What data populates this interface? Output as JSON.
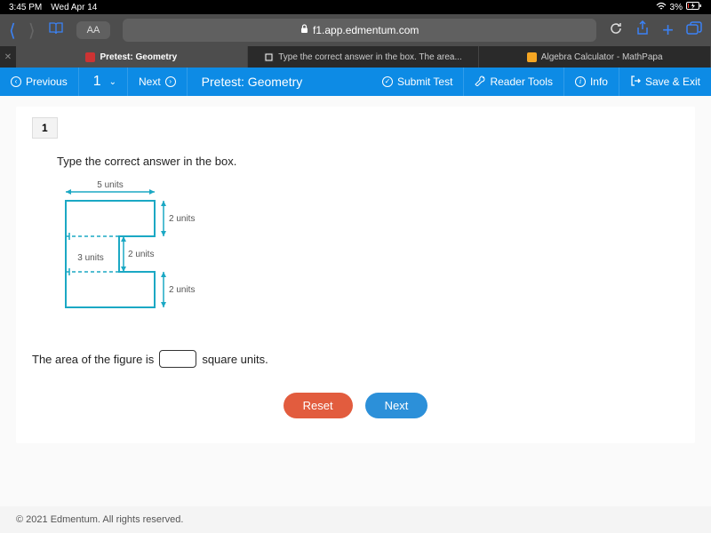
{
  "status": {
    "time": "3:45 PM",
    "date": "Wed Apr 14",
    "battery": "3%"
  },
  "safari": {
    "aa": "AA",
    "url_host": "f1.app.edmentum.com"
  },
  "tabs": [
    {
      "label": "Pretest: Geometry"
    },
    {
      "label": "Type the correct answer in the box. The area..."
    },
    {
      "label": "Algebra Calculator - MathPapa"
    }
  ],
  "appbar": {
    "previous": "Previous",
    "qnum": "1",
    "next": "Next",
    "title": "Pretest: Geometry",
    "submit": "Submit Test",
    "reader": "Reader Tools",
    "info": "Info",
    "save": "Save & Exit"
  },
  "question": {
    "number": "1",
    "prompt": "Type the correct answer in the box.",
    "figure": {
      "top": "5 units",
      "right_upper": "2 units",
      "mid_v": "2 units",
      "mid_h": "3 units",
      "right_lower": "2 units"
    },
    "answer_prefix": "The area of the figure is",
    "answer_suffix": "square units."
  },
  "buttons": {
    "reset": "Reset",
    "next": "Next"
  },
  "footer": "© 2021 Edmentum. All rights reserved."
}
